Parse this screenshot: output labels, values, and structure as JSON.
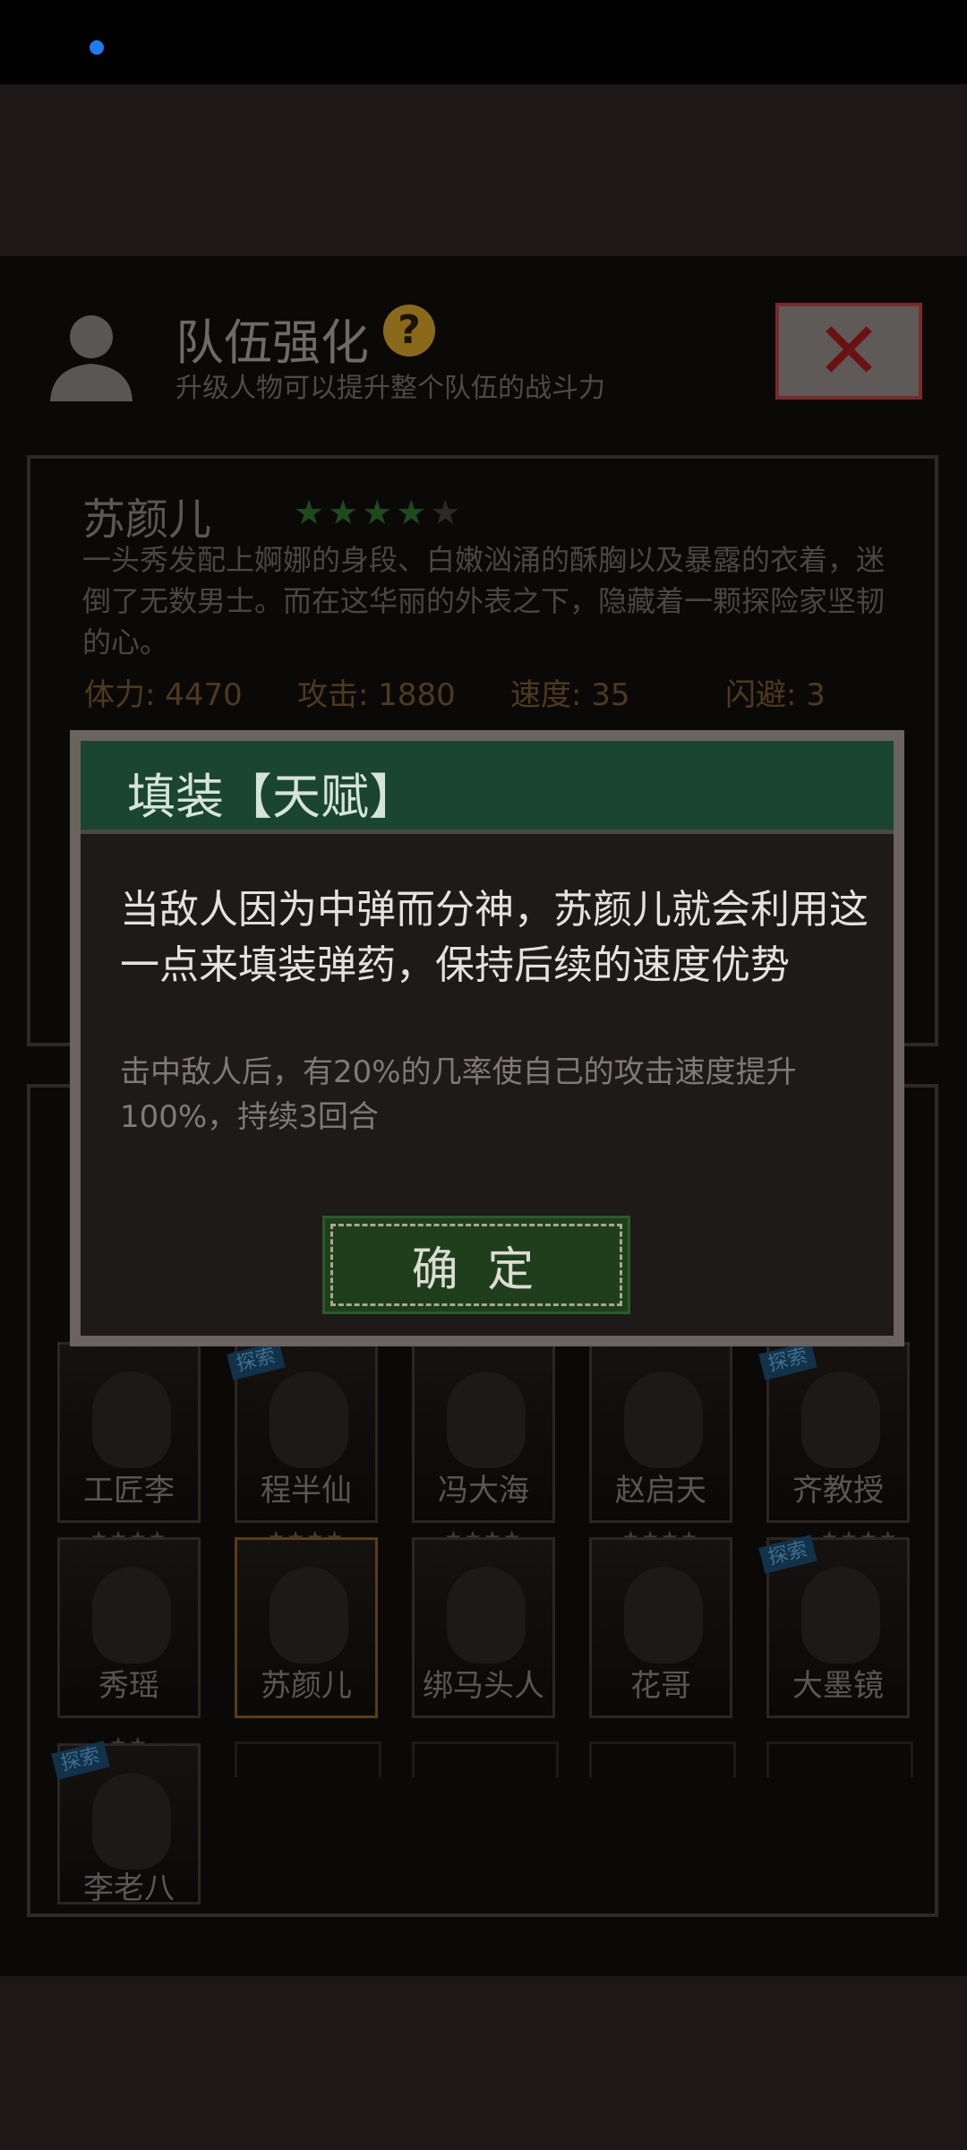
{
  "colors": {
    "accent": "#1a4530",
    "status_dot": "#1d7cf2"
  },
  "header": {
    "title": "队伍强化",
    "subtitle": "升级人物可以提升整个队伍的战斗力",
    "help_icon": "?"
  },
  "character": {
    "name": "苏颜儿",
    "stars_filled": 4,
    "stars_total": 5,
    "description": "一头秀发配上婀娜的身段、白嫩汹涌的酥胸以及暴露的衣着，迷倒了无数男士。而在这华丽的外表之下，隐藏着一颗探险家坚韧的心。",
    "stats": {
      "stamina": "体力: 4470",
      "attack": "攻击: 1880",
      "speed": "速度: 35",
      "dodge": "闪避: 3"
    }
  },
  "roster": {
    "row1": [
      "工匠李",
      "程半仙",
      "冯大海",
      "赵启天",
      "齐教授"
    ],
    "row2": [
      "秀瑶",
      "苏颜儿",
      "绑马头人",
      "花哥",
      "大墨镜"
    ],
    "row3": [
      "李老八"
    ],
    "star_text": "★★★★",
    "star_text_short": "★★",
    "explore_tag": "探索"
  },
  "dialog": {
    "title": "填装【天赋】",
    "body": "当敌人因为中弹而分神，苏颜儿就会利用这一点来填装弹药，保持后续的速度优势",
    "effect": "击中敌人后，有20%的几率使自己的攻击速度提升100%，持续3回合",
    "confirm_label": "确 定"
  }
}
